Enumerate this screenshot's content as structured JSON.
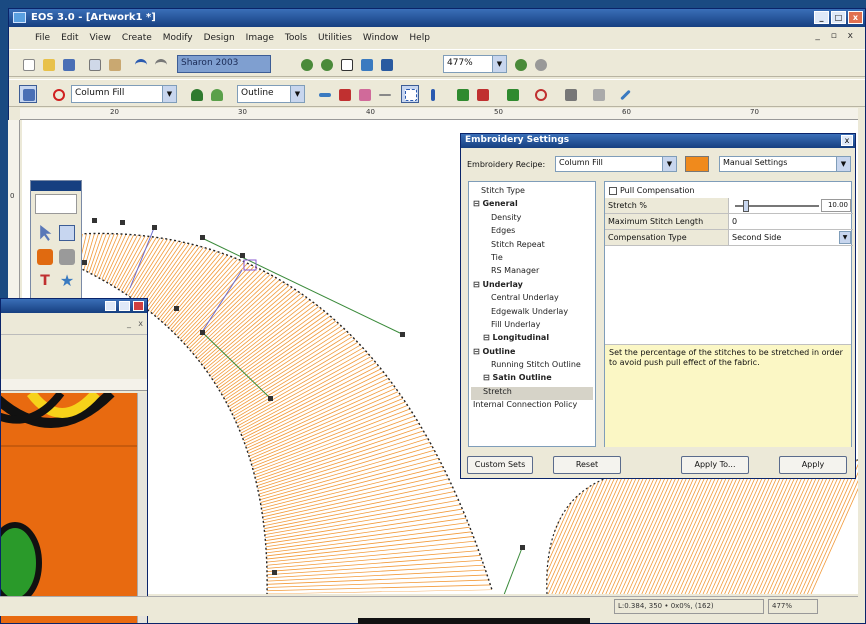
{
  "app": {
    "title": "EOS 3.0 - [Artwork1 *]"
  },
  "menu": [
    "File",
    "Edit",
    "View",
    "Create",
    "Modify",
    "Design",
    "Image",
    "Tools",
    "Utilities",
    "Window",
    "Help"
  ],
  "toolbar1": {
    "design_name": "Sharon 2003",
    "zoom": "477%"
  },
  "toolbar2": {
    "stitch_type": "Column Fill",
    "outline_type": "Outline"
  },
  "ruler": {
    "h_ticks": [
      "20",
      "30",
      "40",
      "50",
      "60",
      "70"
    ],
    "v_ticks": [
      "0"
    ]
  },
  "dialog": {
    "title": "Embroidery Settings",
    "recipe_label": "Embroidery Recipe:",
    "recipe_value": "Column Fill",
    "recipe_color": "#f08a1c",
    "settings_mode": "Manual Settings",
    "tree": [
      {
        "label": "Stitch Type",
        "bold": false
      },
      {
        "label": "General",
        "bold": true
      },
      {
        "label": "Density",
        "bold": false
      },
      {
        "label": "Edges",
        "bold": false
      },
      {
        "label": "Stitch Repeat",
        "bold": false
      },
      {
        "label": "Tie",
        "bold": false
      },
      {
        "label": "RS Manager",
        "bold": false
      },
      {
        "label": "Underlay",
        "bold": true
      },
      {
        "label": "Central Underlay",
        "bold": false
      },
      {
        "label": "Edgewalk Underlay",
        "bold": false
      },
      {
        "label": "Fill Underlay",
        "bold": false
      },
      {
        "label": "Longitudinal",
        "bold": true
      },
      {
        "label": "Outline",
        "bold": true
      },
      {
        "label": "Running Stitch Outline",
        "bold": false
      },
      {
        "label": "Satin Outline",
        "bold": true
      },
      {
        "label": "Stretch",
        "bold": false
      },
      {
        "label": "Internal Connection Policy",
        "bold": false
      }
    ],
    "pull_comp_label": "Pull Compensation",
    "props": [
      {
        "key": "Stretch %",
        "value": "10.00"
      },
      {
        "key": "Maximum Stitch Length",
        "value": "0"
      },
      {
        "key": "Compensation Type",
        "value": "Second Side"
      }
    ],
    "stretch_level": 0.1,
    "description": "Set the percentage of the stitches to be stretched in order to avoid push pull effect of the fabric.",
    "buttons": {
      "custom": "Custom Sets",
      "reset": "Reset",
      "apply_to": "Apply To...",
      "apply": "Apply"
    }
  },
  "status": {
    "coords": "L:0.384, 350 • 0x0%, (162)",
    "zoom": "477%"
  },
  "colors": {
    "stitch": "#f29a3a",
    "window_bg": "#ece9d8",
    "title": "#163f80",
    "art_bg": "#e86a10"
  }
}
